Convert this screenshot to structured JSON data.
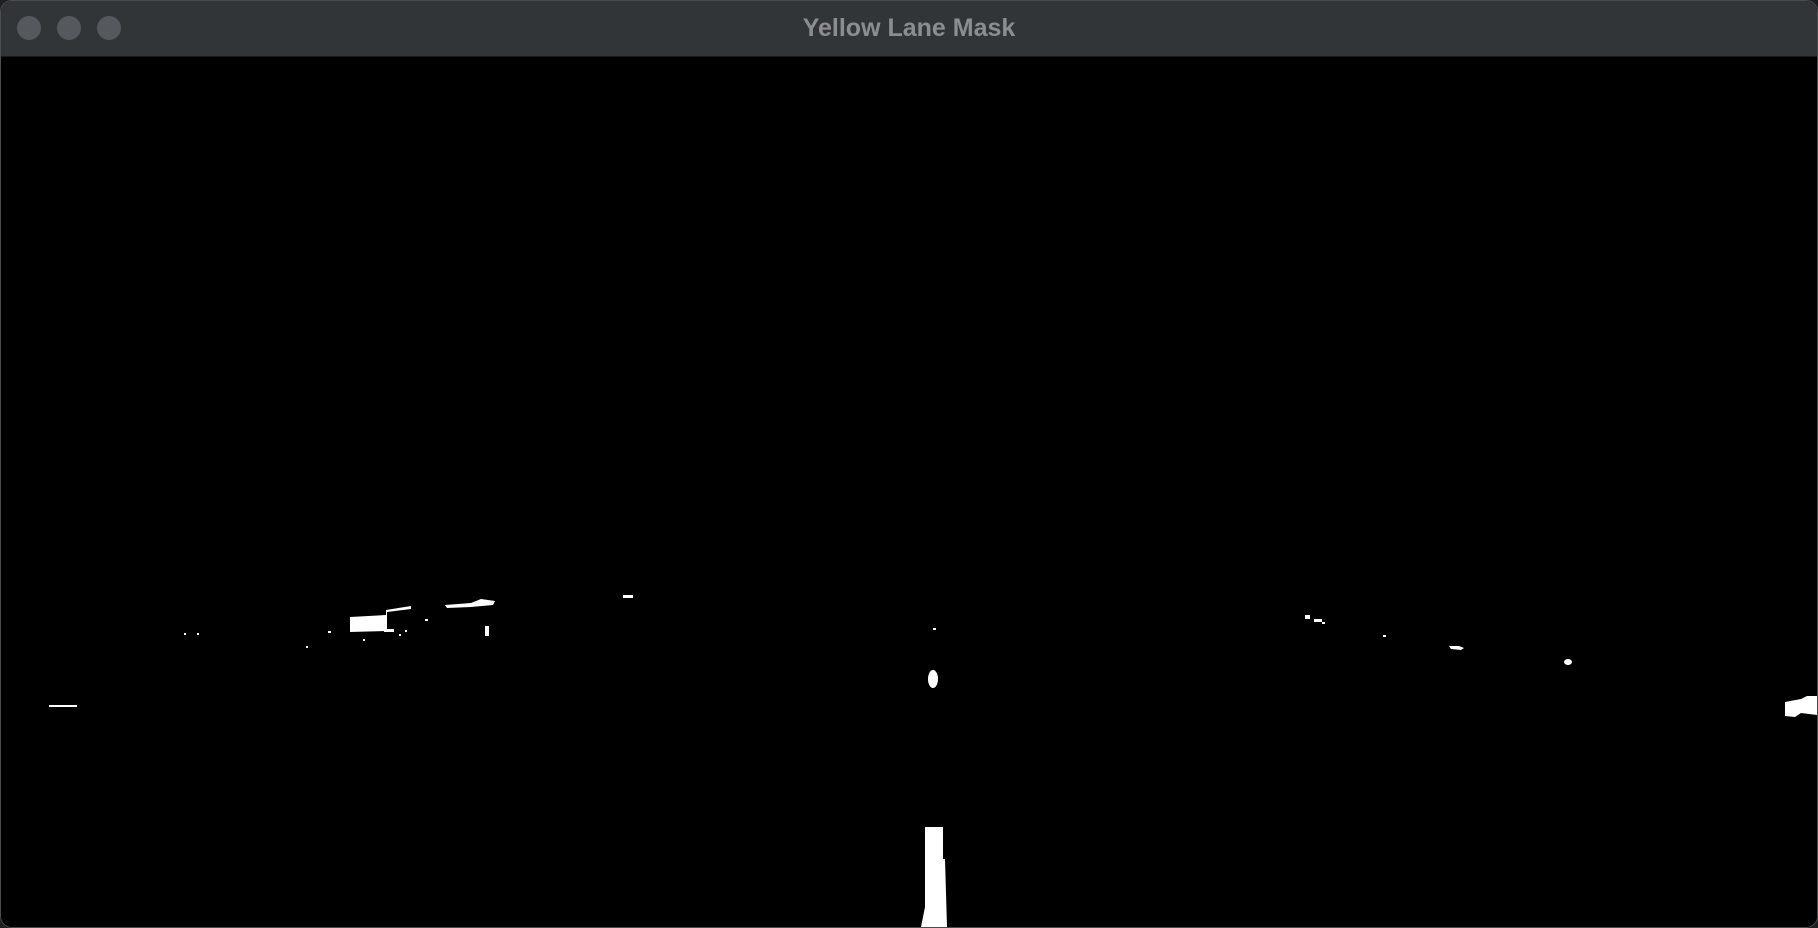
{
  "window": {
    "title": "Yellow Lane Mask"
  },
  "colors": {
    "titlebar": "#323538",
    "title_text": "#8a8d91",
    "traffic_light": "#55585c",
    "mask_background": "#000000",
    "mask_foreground": "#ffffff"
  },
  "icons": {
    "close": "close-button",
    "minimize": "minimize-button",
    "zoom": "zoom-button"
  }
}
